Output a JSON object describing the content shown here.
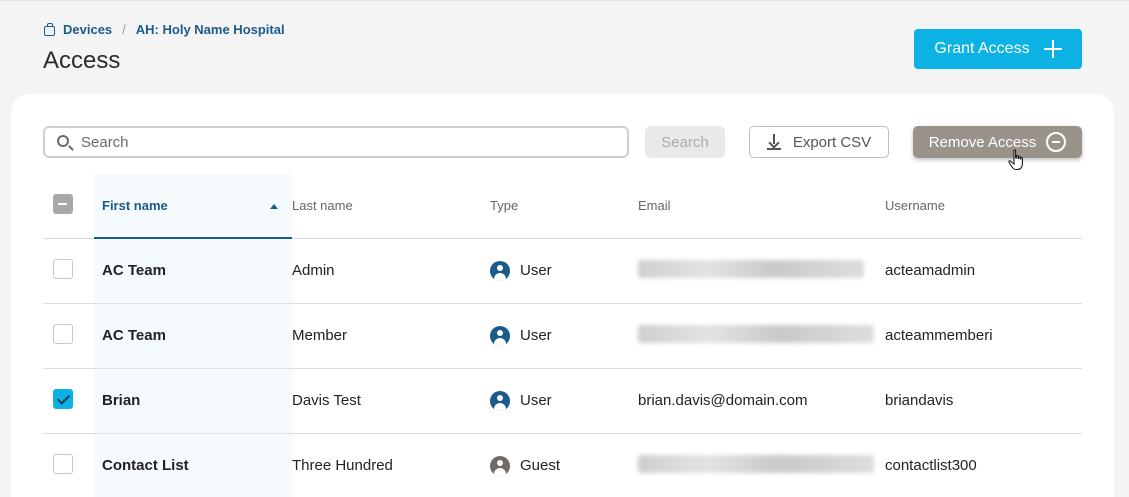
{
  "breadcrumb": {
    "items": [
      {
        "label": "Devices",
        "icon": "device-icon"
      },
      {
        "label": "AH: Holy Name Hospital"
      }
    ],
    "separator": "/"
  },
  "page": {
    "title": "Access"
  },
  "header": {
    "grant_access_label": "Grant Access",
    "grant_icon": "plus-icon"
  },
  "toolbar": {
    "search_placeholder": "Search",
    "search_button_label": "Search",
    "export_label": "Export CSV",
    "remove_label": "Remove Access"
  },
  "table": {
    "columns": [
      "First name",
      "Last name",
      "Type",
      "Email",
      "Username"
    ],
    "sorted_column": "First name",
    "sort_direction": "ascending",
    "select_all_state": "indeterminate",
    "rows": [
      {
        "first": "AC Team",
        "last": "Admin",
        "type": "User",
        "email": "",
        "email_redacted": true,
        "username": "acteamadmin",
        "checked": false
      },
      {
        "first": "AC Team",
        "last": "Member",
        "type": "User",
        "email": "",
        "email_redacted": true,
        "username": "acteammemberi",
        "checked": false
      },
      {
        "first": "Brian",
        "last": "Davis Test",
        "type": "User",
        "email": "brian.davis@domain.com",
        "email_redacted": false,
        "username": "briandavis",
        "checked": true
      },
      {
        "first": "Contact List",
        "last": "Three Hundred",
        "type": "Guest",
        "email": "",
        "email_redacted": true,
        "username": "contactlist300",
        "checked": false
      }
    ]
  },
  "colors": {
    "accent": "#0cb2e3",
    "link": "#1b5b8c",
    "remove_button": "#9a938c",
    "guest_icon": "#6f6a66"
  }
}
